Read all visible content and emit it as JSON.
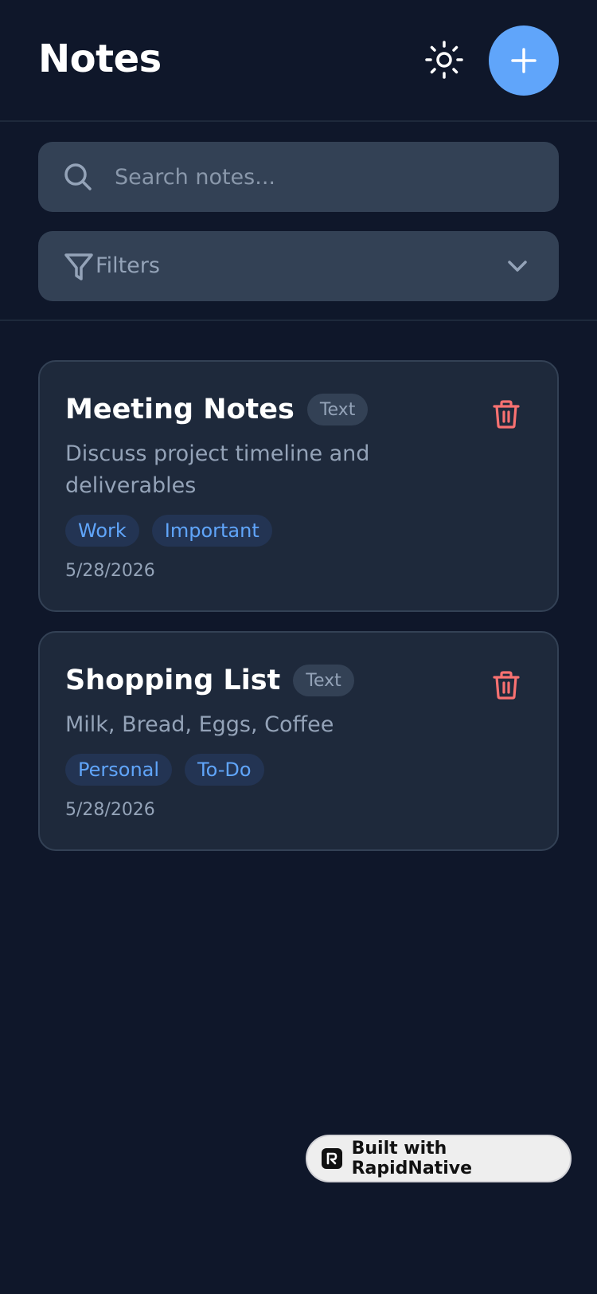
{
  "header": {
    "title": "Notes"
  },
  "search": {
    "placeholder": "Search notes..."
  },
  "filters": {
    "label": "Filters"
  },
  "notes": [
    {
      "title": "Meeting Notes",
      "type": "Text",
      "body": "Discuss project timeline and deliverables",
      "tags": [
        "Work",
        "Important"
      ],
      "date": "5/28/2026"
    },
    {
      "title": "Shopping List",
      "type": "Text",
      "body": "Milk, Bread, Eggs, Coffee",
      "tags": [
        "Personal",
        "To-Do"
      ],
      "date": "5/28/2026"
    }
  ],
  "badge": {
    "label": "Built with RapidNative"
  },
  "colors": {
    "background": "#0f172a",
    "card": "#1e293b",
    "accent": "#60a5fa",
    "danger": "#f87171",
    "muted_text": "#94a3b8"
  }
}
